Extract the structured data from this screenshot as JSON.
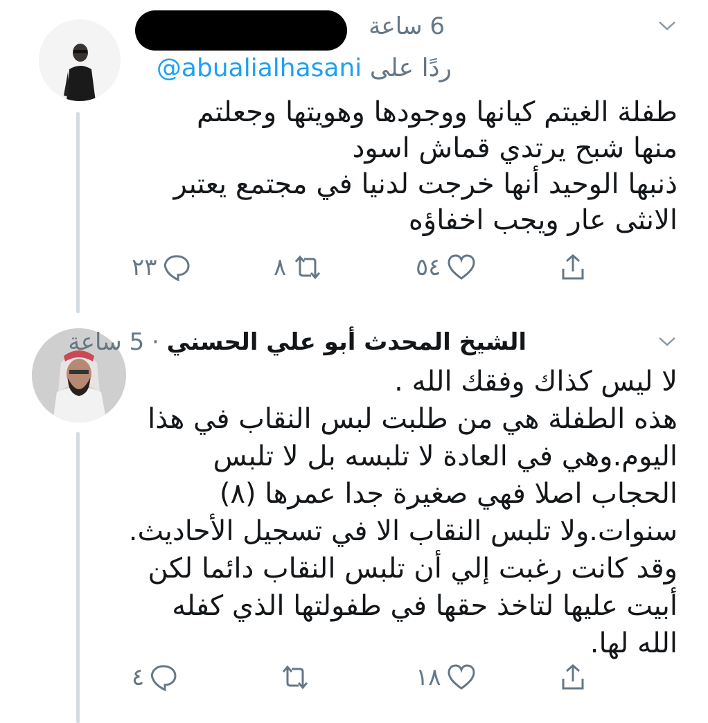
{
  "tweets": [
    {
      "time": "6 ساعة",
      "reply_prefix": "ردًا على",
      "reply_handle": "@abualialhasani",
      "lines": [
        "طفلة الغيتم كيانها ووجودها وهويتها وجعلتم",
        "منها شبح يرتدي قماش اسود",
        "ذنبها الوحيد أنها خرجت لدنيا في مجتمع يعتبر",
        "الانثى عار ويجب اخفاؤه"
      ],
      "counts": {
        "reply": "٢٣",
        "retweet": "٨",
        "like": "٥٤"
      }
    },
    {
      "display_name": "الشيخ المحدث أبو علي الحسني",
      "separator": "·",
      "time": "5 ساعة",
      "lines": [
        "لا ليس كذاك وفقك الله .",
        "هذه الطفلة هي من طلبت لبس النقاب في هذا",
        "اليوم.وهي في العادة لا تلبسه بل لا تلبس",
        "الحجاب اصلا فهي صغيرة جدا عمرها (٨)",
        "سنوات.ولا تلبس النقاب الا في تسجيل الأحاديث.",
        "وقد كانت رغبت إلي أن تلبس النقاب دائما لكن",
        "أبيت عليها لتاخذ حقها في طفولتها الذي كفله",
        "الله لها."
      ],
      "counts": {
        "reply": "٤",
        "retweet": "",
        "like": "١٨"
      }
    }
  ],
  "colors": {
    "accent": "#1da1f2",
    "muted": "#657786",
    "text": "#14171a",
    "thread_line": "#d3dbe2"
  },
  "icons": [
    "chevron-down-icon",
    "reply-icon",
    "retweet-icon",
    "like-icon",
    "share-icon"
  ]
}
